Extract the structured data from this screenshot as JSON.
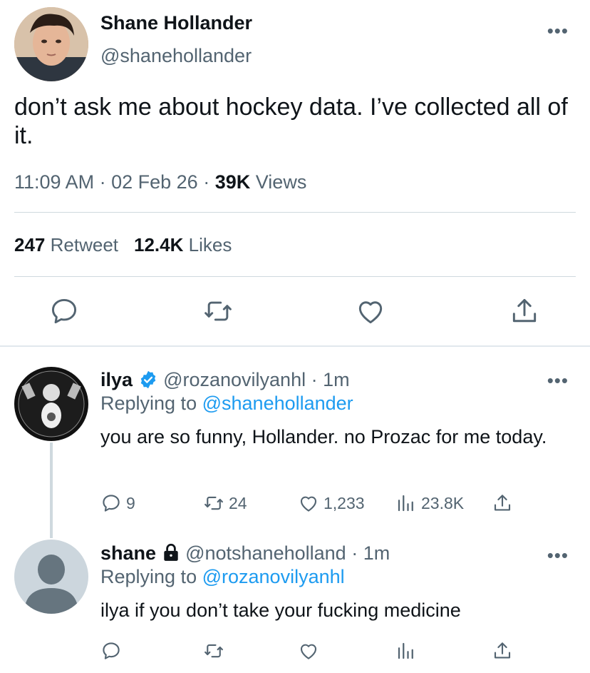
{
  "tweet": {
    "name": "Shane Hollander",
    "handle": "@shanehollander",
    "text": "don’t ask me about hockey data. I’ve collected all of it.",
    "time": "11:09 AM",
    "sep1": "·",
    "date": "02 Feb 26",
    "sep2": "·",
    "views_count": "39K",
    "views_label": "Views",
    "retweets_count": "247",
    "retweets_label": "Retweet",
    "likes_count": "12.4K",
    "likes_label": "Likes",
    "more": "•••"
  },
  "replies": [
    {
      "name": "ilya",
      "verified": true,
      "handle": "@rozanovilyanhl",
      "sep": "·",
      "time": "1m",
      "replying_prefix": "Replying to",
      "replying_to": "@shanehollander",
      "text": "you are so funny, Hollander. no Prozac for me today.",
      "replies": "9",
      "retweets": "24",
      "likes": "1,233",
      "views": "23.8K",
      "more": "•••"
    },
    {
      "name": "shane",
      "locked": true,
      "handle": "@notshaneholland",
      "sep": "·",
      "time": "1m",
      "replying_prefix": "Replying to",
      "replying_to": "@rozanovilyanhl",
      "text": "ilya if you don’t take your fucking medicine",
      "more": "•••"
    }
  ],
  "icons": {
    "reply": "reply-icon",
    "retweet": "retweet-icon",
    "like": "heart-icon",
    "share": "share-icon",
    "views": "views-icon",
    "verified": "verified-badge-icon",
    "lock": "lock-icon"
  },
  "colors": {
    "link": "#1d9bf0",
    "muted": "#536471",
    "text": "#0f1419",
    "divider": "#cfd9de"
  }
}
